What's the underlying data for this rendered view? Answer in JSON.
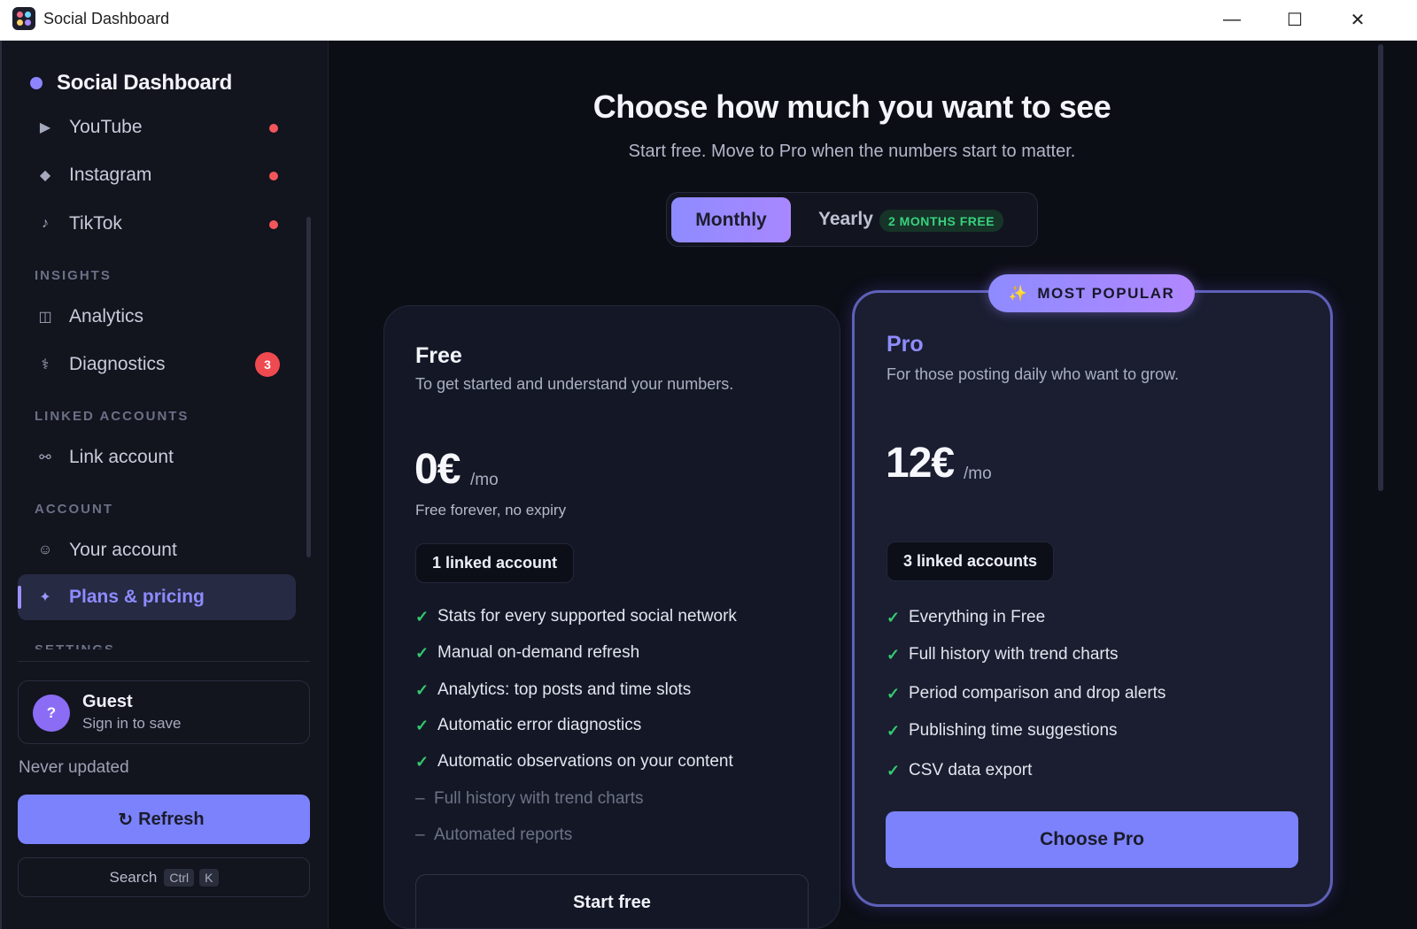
{
  "window": {
    "title": "Social Dashboard",
    "minimize_glyph": "—",
    "maximize_glyph": "☐",
    "close_glyph": "✕"
  },
  "sidebar": {
    "brand": "Social Dashboard",
    "networks": [
      {
        "label": "YouTube",
        "icon": "play-icon",
        "glyph": "▶",
        "alert_dot": true
      },
      {
        "label": "Instagram",
        "icon": "diamond-icon",
        "glyph": "◆",
        "alert_dot": true
      },
      {
        "label": "TikTok",
        "icon": "music-note-icon",
        "glyph": "♪",
        "alert_dot": true
      }
    ],
    "sections": {
      "insights": "INSIGHTS",
      "linked_accounts": "LINKED ACCOUNTS",
      "account": "ACCOUNT",
      "settings": "SETTINGS"
    },
    "insights_items": [
      {
        "label": "Analytics",
        "icon": "columns-icon",
        "glyph": "◫"
      },
      {
        "label": "Diagnostics",
        "icon": "stethoscope-icon",
        "glyph": "⚕",
        "badge": "3"
      }
    ],
    "linked_items": [
      {
        "label": "Link account",
        "icon": "link-icon",
        "glyph": "⚯"
      }
    ],
    "account_items": [
      {
        "label": "Your account",
        "icon": "user-face-icon",
        "glyph": "☺"
      },
      {
        "label": "Plans & pricing",
        "icon": "sparkle-icon",
        "glyph": "✦",
        "active": true
      }
    ],
    "guest": {
      "avatar": "?",
      "name": "Guest",
      "subtitle": "Sign in to save"
    },
    "status": "Never updated",
    "refresh": {
      "icon": "↻",
      "label": "Refresh"
    },
    "search": {
      "label": "Search",
      "keys": [
        "Ctrl",
        "K"
      ]
    }
  },
  "main": {
    "headline": "Choose how much you want to see",
    "subhead": "Start free. Move to Pro when the numbers start to matter.",
    "billing_toggle": {
      "monthly": "Monthly",
      "yearly": "Yearly",
      "yearly_badge": "2 MONTHS FREE",
      "selected": "Monthly"
    },
    "plans": {
      "free": {
        "name": "Free",
        "description": "To get started and understand your numbers.",
        "price": "0€",
        "period": "/mo",
        "note": "Free forever, no expiry",
        "accounts": "1 linked account",
        "features": [
          "Stats for every supported social network",
          "Manual on-demand refresh",
          "Analytics: top posts and time slots",
          "Automatic error diagnostics",
          "Automatic observations on your content"
        ],
        "excluded": [
          "Full history with trend charts",
          "Automated reports"
        ],
        "cta": "Start free"
      },
      "pro": {
        "ribbon_icon": "✨",
        "ribbon": "MOST POPULAR",
        "name": "Pro",
        "description": "For those posting daily who want to grow.",
        "price": "12€",
        "period": "/mo",
        "accounts": "3 linked accounts",
        "features": [
          "Everything in Free",
          "Full history with trend charts",
          "Period comparison and drop alerts",
          "Publishing time suggestions",
          "CSV data export"
        ],
        "cta": "Choose Pro"
      }
    },
    "check_glyph": "✓",
    "dash_glyph": "–"
  },
  "colors": {
    "accent": "#7b82fb",
    "accent_purple": "#a887ff",
    "alert_red": "#f2565b",
    "check_green": "#35c96f",
    "background": "#0c0e16"
  }
}
